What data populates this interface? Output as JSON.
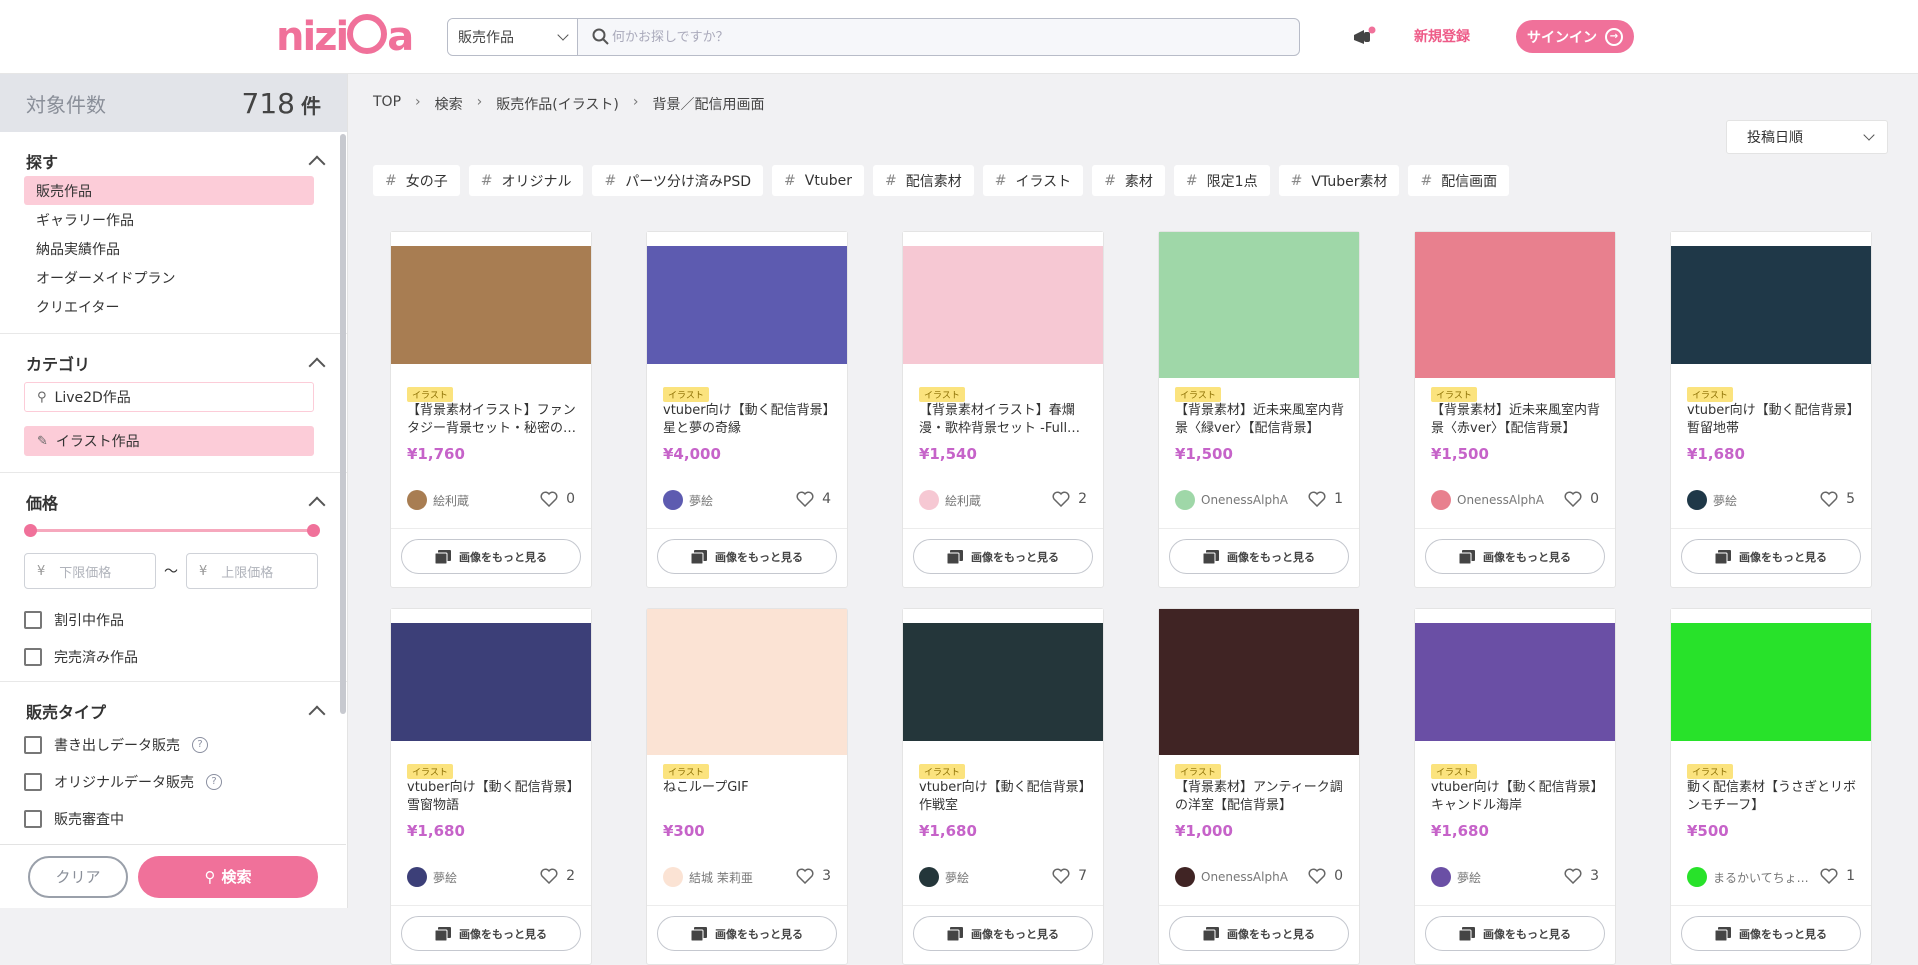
{
  "header": {
    "logo": "nizima",
    "search_category": "販売作品",
    "search_placeholder": "何かお探しですか？",
    "register_label": "新規登録",
    "signin_label": "サインイン",
    "accent": "#f0719a"
  },
  "sidebar": {
    "count_label": "対象件数",
    "count": "718",
    "count_unit": "件",
    "explore": {
      "title": "探す",
      "items": [
        "販売作品",
        "ギャラリー作品",
        "納品実績作品",
        "オーダーメイドプラン",
        "クリエイター"
      ]
    },
    "category": {
      "title": "カテゴリ",
      "items": [
        "Live2D作品",
        "イラスト作品"
      ]
    },
    "price": {
      "title": "価格",
      "min_placeholder": "下限価格",
      "max_placeholder": "上限価格",
      "currency": "¥",
      "tilde": "〜",
      "checks": [
        "割引中作品",
        "完売済み作品"
      ]
    },
    "sale_type": {
      "title": "販売タイプ",
      "checks": [
        "書き出しデータ販売",
        "オリジナルデータ販売",
        "販売審査中"
      ]
    },
    "clear_label": "クリア",
    "search_label": "検索"
  },
  "main": {
    "breadcrumb": [
      "TOP",
      "検索",
      "販売作品(イラスト)",
      "背景／配信用画面"
    ],
    "sort_label": "投稿日順",
    "tags": [
      "女の子",
      "オリジナル",
      "パーツ分け済みPSD",
      "Vtuber",
      "配信素材",
      "イラスト",
      "素材",
      "限定1点",
      "VTuber素材",
      "配信画面"
    ],
    "more_label": "画像をもっと見る",
    "badge": "イラスト",
    "products": [
      {
        "title": "【背景素材イラスト】ファンタジー背景セット・秘密の…",
        "price": "¥1,760",
        "author": "絵利蔵",
        "likes": "0",
        "thumb": "#a87d52"
      },
      {
        "title": "vtuber向け【動く配信背景】星と夢の奇縁",
        "price": "¥4,000",
        "author": "夢絵",
        "likes": "4",
        "thumb": "#5d5bb0"
      },
      {
        "title": "【背景素材イラスト】春爛漫・歌枠背景セット -Full…",
        "price": "¥1,540",
        "author": "絵利蔵",
        "likes": "2",
        "thumb": "#f6c8d3"
      },
      {
        "title": "【背景素材】近未来風室内背景〈緑ver〉【配信背景】",
        "price": "¥1,500",
        "author": "OnenessAlphA",
        "likes": "1",
        "thumb": "#9fd7a8"
      },
      {
        "title": "【背景素材】近未来風室内背景〈赤ver〉【配信背景】",
        "price": "¥1,500",
        "author": "OnenessAlphA",
        "likes": "0",
        "thumb": "#e8808e"
      },
      {
        "title": "vtuber向け【動く配信背景】暫留地帯",
        "price": "¥1,680",
        "author": "夢絵",
        "likes": "5",
        "thumb": "#1f3848"
      },
      {
        "title": "vtuber向け【動く配信背景】雪窗物語",
        "price": "¥1,680",
        "author": "夢絵",
        "likes": "2",
        "thumb": "#3c3f78"
      },
      {
        "title": "ねこループGIF",
        "price": "¥300",
        "author": "結城 茉莉亜",
        "likes": "3",
        "thumb": "#fbe3d4"
      },
      {
        "title": "vtuber向け【動く配信背景】作戦室",
        "price": "¥1,680",
        "author": "夢絵",
        "likes": "7",
        "thumb": "#24363a"
      },
      {
        "title": "【背景素材】アンティーク調の洋室【配信背景】",
        "price": "¥1,000",
        "author": "OnenessAlphA",
        "likes": "0",
        "thumb": "#402424"
      },
      {
        "title": "vtuber向け【動く配信背景】キャンドル海岸",
        "price": "¥1,680",
        "author": "夢絵",
        "likes": "3",
        "thumb": "#6a4fa5"
      },
      {
        "title": "動く配信素材【うさぎとリボンモチーフ】",
        "price": "¥500",
        "author": "まるかいてちょ…",
        "likes": "1",
        "thumb": "#28e22a"
      }
    ]
  }
}
